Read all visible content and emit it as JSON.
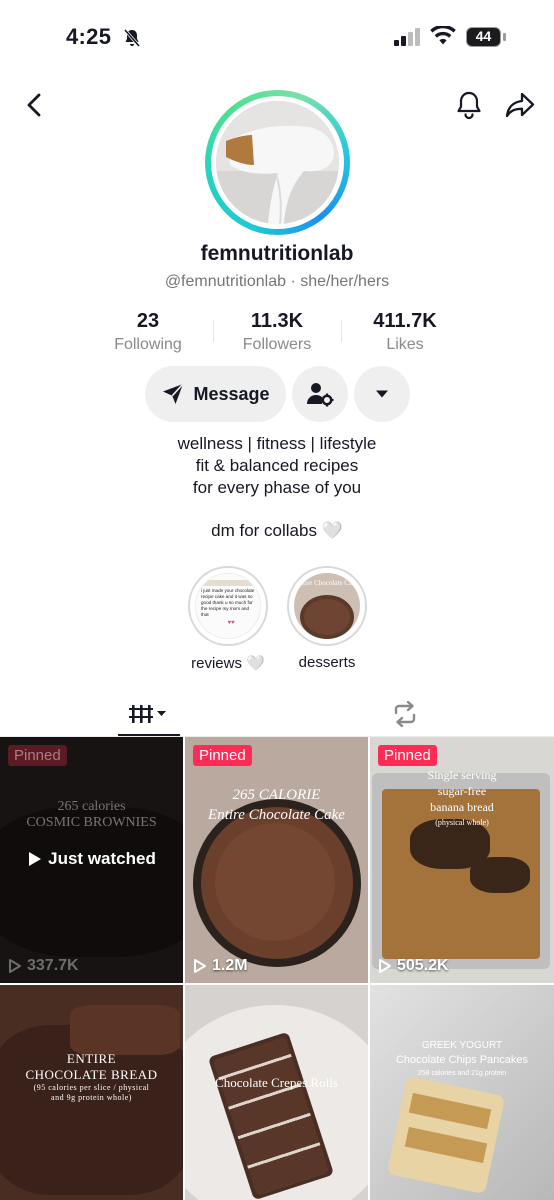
{
  "status_bar": {
    "time": "4:25",
    "battery": "44"
  },
  "profile": {
    "username": "femnutritionlab",
    "handle": "@femnutritionlab",
    "pronouns": "she/her/hers",
    "separator": "·"
  },
  "stats": [
    {
      "value": "23",
      "label": "Following"
    },
    {
      "value": "11.3K",
      "label": "Followers"
    },
    {
      "value": "411.7K",
      "label": "Likes"
    }
  ],
  "actions": {
    "message_label": "Message"
  },
  "bio": {
    "lines": [
      "wellness | fitness | lifestyle",
      "fit & balanced recipes",
      "for every phase of you"
    ],
    "dm_line": "dm for collabs 🤍"
  },
  "highlights": [
    {
      "label": "reviews 🤍",
      "thumb_text": "i just made your chocolate recipe cake and it was so good thank u so much for the recipe my mom and that"
    },
    {
      "label": "desserts",
      "thumb_text": "Entire Chocolate Cake"
    }
  ],
  "videos": [
    {
      "pinned": "Pinned",
      "views": "337.7K",
      "overlay_lines": [
        "265 calories",
        "COSMIC BROWNIES"
      ],
      "status": "Just watched"
    },
    {
      "pinned": "Pinned",
      "views": "1.2M",
      "overlay_lines": [
        "265 CALORIE",
        "Entire Chocolate Cake"
      ]
    },
    {
      "pinned": "Pinned",
      "views": "505.2K",
      "overlay_lines": [
        "Single serving",
        "sugar-free",
        "banana bread",
        "(physical whole)"
      ]
    },
    {
      "overlay_lines": [
        "ENTIRE",
        "CHOCOLATE BREAD",
        "(95 calories per slice / physical",
        "and 9g protein whole)"
      ]
    },
    {
      "overlay_lines": [
        "Chocolate Crepes Rolls"
      ]
    },
    {
      "overlay_lines": [
        "GREEK YOGURT",
        "Chocolate Chips Pancakes",
        "258 calories and 21g protein"
      ]
    }
  ],
  "colors": {
    "accent": "#fe2c55",
    "text": "#161823",
    "muted": "#8a8a8a",
    "button_bg": "#efefef"
  }
}
